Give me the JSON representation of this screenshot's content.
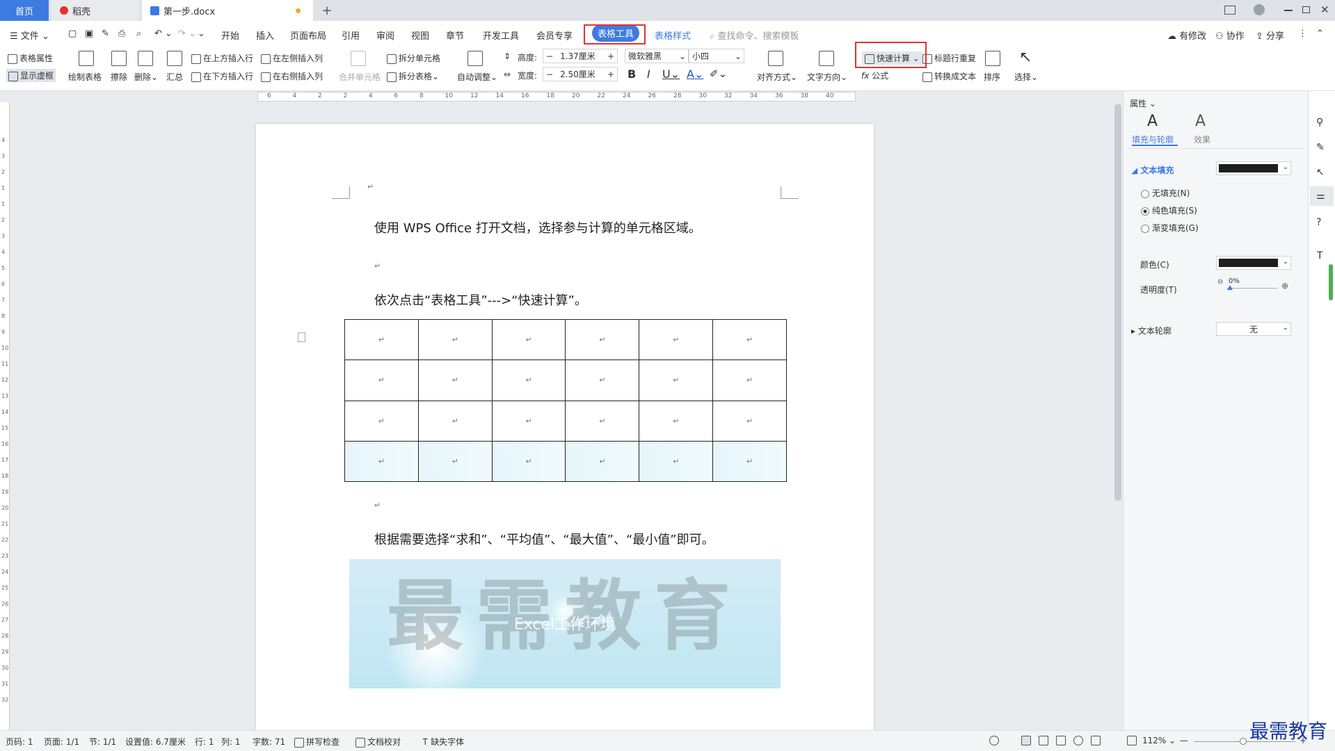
{
  "tabs": {
    "home": "首页",
    "daoke": "稻壳",
    "doc": "第一步.docx",
    "plus": "+"
  },
  "menu": {
    "file": "文件",
    "items": [
      "开始",
      "插入",
      "页面布局",
      "引用",
      "审阅",
      "视图",
      "章节",
      "开发工具",
      "会员专享"
    ],
    "active": "表格工具",
    "table_style": "表格样式",
    "search": "查找命令、搜索模板",
    "right": {
      "changes": "有修改",
      "collab": "协作",
      "share": "分享"
    }
  },
  "ribbon": {
    "table_props": "表格属性",
    "show_grid": "显示虚框",
    "draw_table": "绘制表格",
    "erase": "擦除",
    "delete": "删除",
    "summary": "汇总",
    "insert_above": "在上方插入行",
    "insert_below": "在下方插入行",
    "insert_left": "在左侧插入列",
    "insert_right": "在右侧插入列",
    "merge_cells": "合并单元格",
    "split_cells": "拆分单元格",
    "split_table": "拆分表格",
    "auto_adjust": "自动调整",
    "height_label": "高度:",
    "height_value": "1.37厘米",
    "width_label": "宽度:",
    "width_value": "2.50厘米",
    "font_name": "微软雅黑",
    "font_size": "小四",
    "align": "对齐方式",
    "text_direction": "文字方向",
    "quick_calc": "快速计算",
    "formula": "公式",
    "repeat_header": "标题行重复",
    "convert_text": "转换成文本",
    "sort": "排序",
    "select": "选择"
  },
  "ruler": {
    "h_ticks": [
      "6",
      "4",
      "2",
      "2",
      "4",
      "6",
      "8",
      "10",
      "12",
      "14",
      "16",
      "18",
      "20",
      "22",
      "24",
      "26",
      "28",
      "30",
      "32",
      "34",
      "36",
      "38",
      "40"
    ],
    "v_ticks": [
      "4",
      "3",
      "2",
      "1",
      "1",
      "2",
      "3",
      "4",
      "5",
      "6",
      "7",
      "8",
      "9",
      "10",
      "11",
      "12",
      "13",
      "14",
      "15",
      "16",
      "17",
      "18",
      "19",
      "20",
      "21",
      "22",
      "23",
      "24",
      "25",
      "26",
      "27",
      "28",
      "29",
      "30",
      "31",
      "32"
    ]
  },
  "document": {
    "line1": "使用 WPS Office 打开文档，选择参与计算的单元格区域。",
    "line2": "依次点击“表格工具”--->“快速计算”。",
    "line3": "根据需要选择“求和”、“平均值”、“最大值”、“最小值”即可。",
    "mark": "↵",
    "table_rows": 4,
    "table_cols": 6,
    "banner_title": "最需教育",
    "banner_sub": "Excel工作环境"
  },
  "pane": {
    "header": "属性",
    "tab_fill": "填充与轮廓",
    "tab_effect": "效果",
    "text_fill": "文本填充",
    "no_fill": "无填充(N)",
    "solid_fill": "纯色填充(S)",
    "gradient_fill": "渐变填充(G)",
    "color_label": "颜色(C)",
    "transparency_label": "透明度(T)",
    "transparency_value": "0%",
    "text_outline": "文本轮廓",
    "outline_value": "无"
  },
  "status": {
    "page_no": "页码: 1",
    "pages": "页面: 1/1",
    "section": "节: 1/1",
    "setting": "设置值: 6.7厘米",
    "row": "行: 1",
    "col": "列: 1",
    "words": "字数: 71",
    "spell": "拼写检查",
    "proof": "文档校对",
    "missing_font": "缺失字体",
    "zoom": "112%"
  },
  "watermark": "最需教育",
  "colors": {
    "accent": "#3d7be0",
    "highlight": "#e5322d"
  }
}
